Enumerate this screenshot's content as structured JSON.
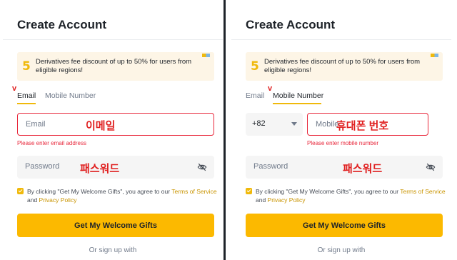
{
  "left": {
    "title": "Create Account",
    "promo": {
      "badge": "5",
      "text": "Derivatives fee discount of up to 50% for users from eligible regions!"
    },
    "tabs": [
      {
        "label": "Email",
        "active": true
      },
      {
        "label": "Mobile Number",
        "active": false
      }
    ],
    "marker": "v",
    "email_field": {
      "placeholder": "Email",
      "annotation": "이메일",
      "error": "Please enter email address"
    },
    "password_field": {
      "placeholder": "Password",
      "annotation": "패스워드"
    },
    "agreement": {
      "prefix": "By clicking \"Get My Welcome Gifts\", you agree to our ",
      "terms_link": "Terms of Service",
      "and": " and ",
      "privacy_link": "Privacy Policy"
    },
    "cta_label": "Get My Welcome Gifts",
    "or_text": "Or sign up with"
  },
  "right": {
    "title": "Create Account",
    "promo": {
      "badge": "5",
      "text": "Derivatives fee discount of up to 50% for users from eligible regions!"
    },
    "tabs": [
      {
        "label": "Email",
        "active": false
      },
      {
        "label": "Mobile Number",
        "active": true
      }
    ],
    "marker": "v",
    "country_code": "+82",
    "mobile_field": {
      "placeholder": "Mobile",
      "annotation": "휴대폰 번호",
      "error": "Please enter mobile number"
    },
    "password_field": {
      "placeholder": "Password",
      "annotation": "패스워드"
    },
    "agreement": {
      "prefix": "By clicking \"Get My Welcome Gifts\", you agree to our ",
      "terms_link": "Terms of Service",
      "and": " and ",
      "privacy_link": "Privacy Policy"
    },
    "cta_label": "Get My Welcome Gifts",
    "or_text": "Or sign up with"
  },
  "colors": {
    "brand": "#fcb900",
    "error": "#e8273b",
    "annotation": "#e02020",
    "promo_bg": "#fdf5e6"
  },
  "icons": {
    "password_toggle": "eye-slash-icon",
    "country_dropdown": "chevron-down-icon",
    "promo_badge": "five-badge-icon"
  }
}
